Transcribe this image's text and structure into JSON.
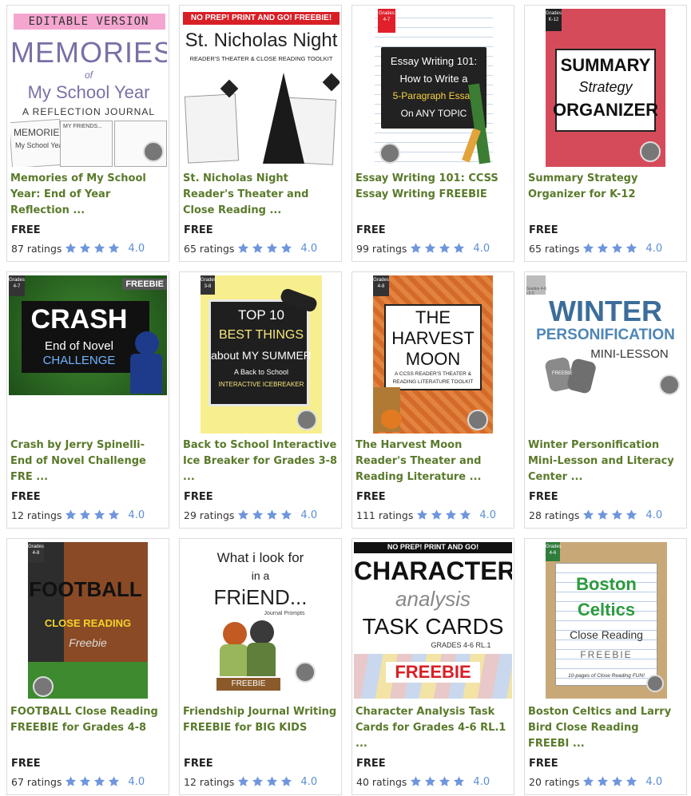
{
  "products": [
    {
      "title": "Memories of My School Year: End of Year Reflection ...",
      "price": "FREE",
      "ratings": "87 ratings",
      "score": "4.0",
      "cover": {
        "banner": "EDITABLE VERSION",
        "line1": "MEMORIES",
        "line2": "of",
        "line3": "My School Year",
        "line4": "A REFLECTION JOURNAL",
        "small1": "MEMORIES",
        "small2": "My School Year",
        "small3": "MY FRIENDS..."
      }
    },
    {
      "title": "St. Nicholas Night Reader's Theater and Close Reading ...",
      "price": "FREE",
      "ratings": "65 ratings",
      "score": "4.0",
      "cover": {
        "banner": "NO PREP! PRINT AND GO! FREEBIE!",
        "line1": "St. Nicholas Night",
        "line2": "READER'S THEATER & CLOSE READING TOOLKIT"
      }
    },
    {
      "title": "Essay Writing 101: CCSS Essay Writing FREEBIE",
      "price": "FREE",
      "ratings": "99 ratings",
      "score": "4.0",
      "cover": {
        "badge": "Grades 4-7",
        "line1": "Essay Writing 101:",
        "line2": "How to Write a",
        "line3": "5-Paragraph Essay",
        "line4": "On ANY TOPIC"
      }
    },
    {
      "title": "Summary Strategy Organizer for K-12",
      "price": "FREE",
      "ratings": "65 ratings",
      "score": "4.0",
      "cover": {
        "badge": "Grades K-12",
        "line1": "SUMMARY",
        "line2": "Strategy",
        "line3": "ORGANIZER"
      }
    },
    {
      "title": "Crash by Jerry Spinelli- End of Novel Challenge FRE ...",
      "price": "FREE",
      "ratings": "12 ratings",
      "score": "4.0",
      "cover": {
        "badge": "Grades 4-7",
        "tag": "FREEBIE",
        "line1": "CRASH",
        "line2": "End of Novel",
        "line3": "CHALLENGE"
      }
    },
    {
      "title": "Back to School Interactive Ice Breaker for Grades 3-8 ...",
      "price": "FREE",
      "ratings": "29 ratings",
      "score": "4.0",
      "cover": {
        "badge": "Grades 3-8",
        "line1": "TOP 10",
        "line2": "BEST THINGS",
        "line3": "about MY SUMMER",
        "line4": "A Back to School",
        "line5": "INTERACTIVE ICEBREAKER"
      }
    },
    {
      "title": "The Harvest Moon Reader's Theater and Reading Literature ...",
      "price": "FREE",
      "ratings": "111 ratings",
      "score": "4.0",
      "cover": {
        "badge": "Grades 4-8",
        "line1": "THE",
        "line2": "HARVEST",
        "line3": "MOON",
        "line4": "A CCSS READER'S THEATER &",
        "line5": "READING LITERATURE TOOLKIT"
      }
    },
    {
      "title": "Winter Personification Mini-Lesson and Literacy Center ...",
      "price": "FREE",
      "ratings": "28 ratings",
      "score": "4.0",
      "cover": {
        "badge": "Grades 4-6 L5.5",
        "line1": "WINTER",
        "line2": "PERSONIFICATION",
        "line3": "MINI-LESSON",
        "tag": "FREEBIE"
      }
    },
    {
      "title": "FOOTBALL Close Reading FREEBIE for Grades 4-8",
      "price": "FREE",
      "ratings": "67 ratings",
      "score": "4.0",
      "cover": {
        "badge": "Grades 4-8",
        "line1": "FOOTBALL",
        "line2": "CLOSE READING",
        "line3": "Freebie"
      }
    },
    {
      "title": "Friendship Journal Writing FREEBIE for BIG KIDS",
      "price": "FREE",
      "ratings": "12 ratings",
      "score": "4.0",
      "cover": {
        "line1": "What i look for",
        "line2": "in a",
        "line3": "FRiEND...",
        "line4": "Journal Prompts",
        "tag": "FREEBIE"
      }
    },
    {
      "title": "Character Analysis Task Cards for Grades 4-6 RL.1 ...",
      "price": "FREE",
      "ratings": "40 ratings",
      "score": "4.0",
      "cover": {
        "banner": "NO PREP! PRINT AND GO!",
        "line1": "CHARACTER",
        "line2": "analysis",
        "line3": "TASK CARDS",
        "line4": "GRADES 4-6 RL.1",
        "tag": "FREEBIE"
      }
    },
    {
      "title": "Boston Celtics and Larry Bird Close Reading FREEBI ...",
      "price": "FREE",
      "ratings": "20 ratings",
      "score": "4.0",
      "cover": {
        "badge": "Grades 4-6",
        "line1": "Boston",
        "line2": "Celtics",
        "line3": "Close Reading",
        "line4": "FREEBIE",
        "line5": "10-pages of Close Reading FUN!"
      }
    }
  ],
  "colors": {
    "title_green": "#5a7a2b",
    "star_blue": "#6f96dd",
    "score_blue": "#5a8ed6"
  }
}
